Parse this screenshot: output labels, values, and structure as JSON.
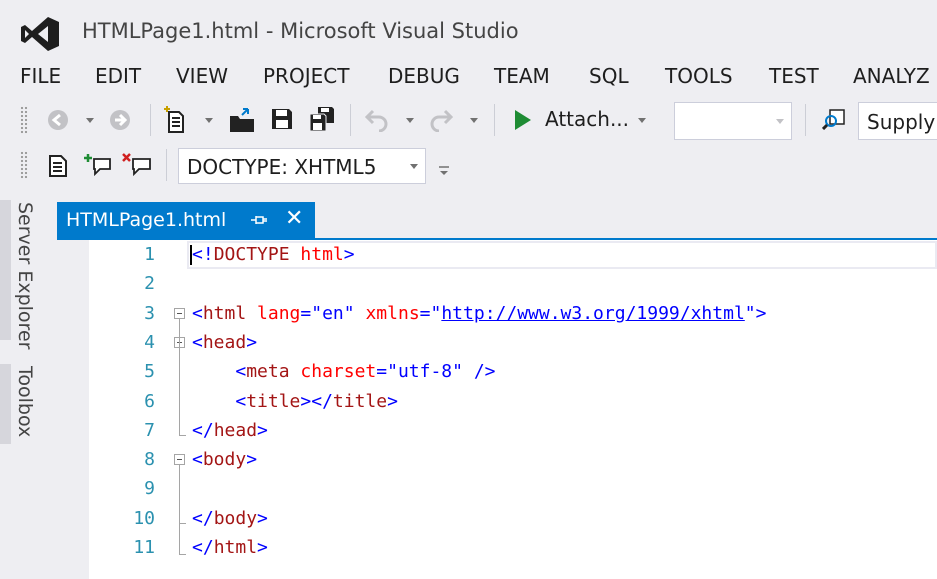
{
  "window": {
    "title": "HTMLPage1.html - Microsoft Visual Studio"
  },
  "menu": {
    "items": [
      "FILE",
      "EDIT",
      "VIEW",
      "PROJECT",
      "DEBUG",
      "TEAM",
      "SQL",
      "TOOLS",
      "TEST",
      "ANALYZ"
    ]
  },
  "toolbar": {
    "attach_label": "Attach...",
    "config_combo_value": "",
    "find_combo_value": "Supply",
    "doctype_combo_value": "DOCTYPE: XHTML5"
  },
  "side_panels": {
    "server_explorer": "Server Explorer",
    "toolbox": "Toolbox"
  },
  "document_tab": {
    "label": "HTMLPage1.html",
    "close_glyph": "✕"
  },
  "editor": {
    "lines": [
      {
        "n": "1",
        "parts": [
          [
            "del",
            "<!"
          ],
          [
            "tag",
            "DOCTYPE"
          ],
          [
            "text",
            " "
          ],
          [
            "attr",
            "html"
          ],
          [
            "del",
            ">"
          ]
        ]
      },
      {
        "n": "2",
        "parts": []
      },
      {
        "n": "3",
        "parts": [
          [
            "del",
            "<"
          ],
          [
            "tag",
            "html"
          ],
          [
            "text",
            " "
          ],
          [
            "attr",
            "lang"
          ],
          [
            "del",
            "=\""
          ],
          [
            "val",
            "en"
          ],
          [
            "del",
            "\""
          ],
          [
            "text",
            " "
          ],
          [
            "attr",
            "xmlns"
          ],
          [
            "del",
            "=\""
          ],
          [
            "link",
            "http://www.w3.org/1999/xhtml"
          ],
          [
            "del",
            "\">"
          ]
        ]
      },
      {
        "n": "4",
        "parts": [
          [
            "del",
            "<"
          ],
          [
            "tag",
            "head"
          ],
          [
            "del",
            ">"
          ]
        ]
      },
      {
        "n": "5",
        "parts": [
          [
            "text",
            "    "
          ],
          [
            "del",
            "<"
          ],
          [
            "tag",
            "meta"
          ],
          [
            "text",
            " "
          ],
          [
            "attr",
            "charset"
          ],
          [
            "del",
            "=\""
          ],
          [
            "val",
            "utf-8"
          ],
          [
            "del",
            "\""
          ],
          [
            "text",
            " "
          ],
          [
            "del",
            "/>"
          ]
        ]
      },
      {
        "n": "6",
        "parts": [
          [
            "text",
            "    "
          ],
          [
            "del",
            "<"
          ],
          [
            "tag",
            "title"
          ],
          [
            "del",
            "></"
          ],
          [
            "tag",
            "title"
          ],
          [
            "del",
            ">"
          ]
        ]
      },
      {
        "n": "7",
        "parts": [
          [
            "del",
            "</"
          ],
          [
            "tag",
            "head"
          ],
          [
            "del",
            ">"
          ]
        ]
      },
      {
        "n": "8",
        "parts": [
          [
            "del",
            "<"
          ],
          [
            "tag",
            "body"
          ],
          [
            "del",
            ">"
          ]
        ]
      },
      {
        "n": "9",
        "parts": []
      },
      {
        "n": "10",
        "parts": [
          [
            "del",
            "</"
          ],
          [
            "tag",
            "body"
          ],
          [
            "del",
            ">"
          ]
        ]
      },
      {
        "n": "11",
        "parts": [
          [
            "del",
            "</"
          ],
          [
            "tag",
            "html"
          ],
          [
            "del",
            ">"
          ]
        ]
      }
    ]
  },
  "colors": {
    "accent": "#007acc",
    "line_number": "#2b91af",
    "tag_name": "#a31515",
    "attribute": "#ff0000",
    "delimiter": "#0000ff"
  }
}
